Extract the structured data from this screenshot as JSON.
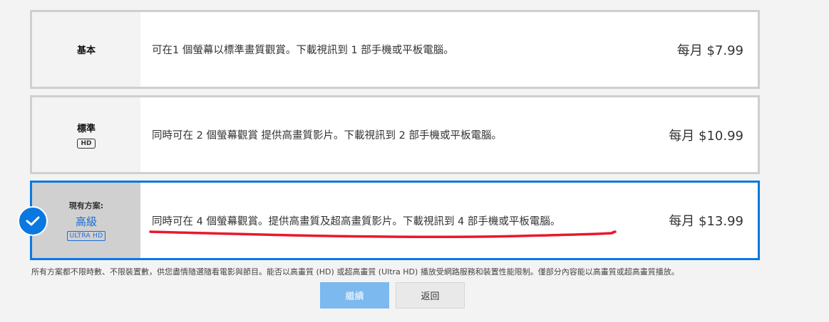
{
  "plans": [
    {
      "name": "基本",
      "desc": "可在1 個螢幕以標準畫質觀賞。下載視訊到 1 部手機或平板電腦。",
      "price": "每月 $7.99"
    },
    {
      "name": "標準",
      "badge": "HD",
      "desc": "同時可在 2 個螢幕觀賞 提供高畫質影片。下載視訊到 2 部手機或平板電腦。",
      "price": "每月 $10.99"
    },
    {
      "current_label": "現有方案:",
      "name": "高級",
      "badge": "ULTRA HD",
      "desc": "同時可在 4 個螢幕觀賞。提供高畫質及超高畫質影片。下載視訊到 4 部手機或平板電腦。",
      "price": "每月 $13.99"
    }
  ],
  "footnote": "所有方案都不限時數、不限裝置數，供您盡情隨選隨看電影與節目。能否以高畫質 (HD) 或超高畫質 (Ultra HD) 播放受網路服務和裝置性能限制。僅部分內容能以高畫質或超高畫質播放。",
  "buttons": {
    "continue": "繼續",
    "back": "返回"
  },
  "colors": {
    "selected_border": "#0a78e0",
    "accent_text": "#1a6ed8",
    "continue_button": "#7cb9ef",
    "annotation_underline": "#e8192c"
  },
  "icons": {
    "selected_marker": "check-circle-icon"
  }
}
